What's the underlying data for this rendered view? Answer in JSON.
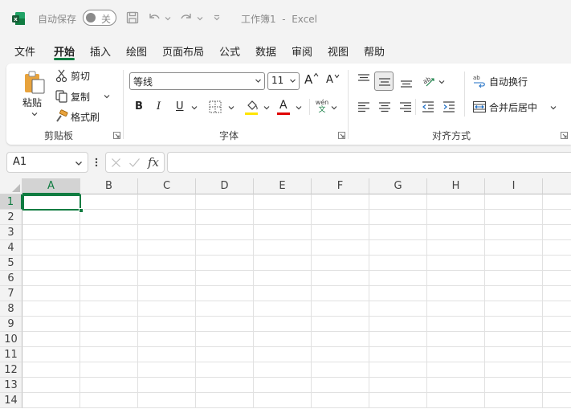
{
  "titlebar": {
    "autosave_label": "自动保存",
    "autosave_state": "关",
    "doc_title": "工作簿1  -  Excel"
  },
  "tabs": [
    {
      "label": "文件",
      "active": false
    },
    {
      "label": "开始",
      "active": true
    },
    {
      "label": "插入",
      "active": false
    },
    {
      "label": "绘图",
      "active": false
    },
    {
      "label": "页面布局",
      "active": false
    },
    {
      "label": "公式",
      "active": false
    },
    {
      "label": "数据",
      "active": false
    },
    {
      "label": "审阅",
      "active": false
    },
    {
      "label": "视图",
      "active": false
    },
    {
      "label": "帮助",
      "active": false
    }
  ],
  "clipboard": {
    "paste": "粘贴",
    "cut": "剪切",
    "copy": "复制",
    "format_painter": "格式刷",
    "group_label": "剪贴板"
  },
  "font": {
    "name": "等线",
    "size": "11",
    "grow": "A",
    "shrink": "A",
    "bold": "B",
    "italic": "I",
    "underline": "U",
    "font_color_glyph": "A",
    "phonetic_top": "wén",
    "phonetic_bottom": "文",
    "group_label": "字体",
    "highlight_color": "#ffe500",
    "font_color": "#e00000"
  },
  "alignment": {
    "wrap_text": "自动换行",
    "merge_center": "合并后居中",
    "group_label": "对齐方式"
  },
  "formula_bar": {
    "name_box": "A1",
    "fx": "fx",
    "value": ""
  },
  "grid": {
    "columns": [
      "A",
      "B",
      "C",
      "D",
      "E",
      "F",
      "G",
      "H",
      "I"
    ],
    "rows": [
      "1",
      "2",
      "3",
      "4",
      "5",
      "6",
      "7",
      "8",
      "9",
      "10",
      "11",
      "12",
      "13",
      "14"
    ],
    "selected_cell": "A1"
  },
  "colors": {
    "accent": "#107c41"
  }
}
